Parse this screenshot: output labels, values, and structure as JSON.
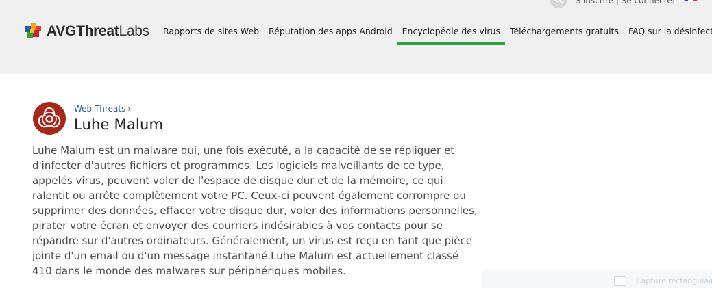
{
  "top_bar": {
    "login_text": "S'inscrire | Se connecter",
    "search_icon": "search-icon",
    "flag_icon": "flag-fr-icon"
  },
  "logo": {
    "part1": "AVG",
    "part2": "Threat",
    "part3": "Labs"
  },
  "nav": {
    "items": [
      {
        "label": "Rapports de sites Web",
        "active": false
      },
      {
        "label": "Réputation des apps Android",
        "active": false
      },
      {
        "label": "Encyclopédie des virus",
        "active": true
      },
      {
        "label": "Téléchargements gratuits",
        "active": false
      },
      {
        "label": "FAQ sur la désinfection",
        "active": false
      }
    ]
  },
  "article": {
    "icon": "biohazard-icon",
    "breadcrumb": "Web Threats",
    "breadcrumb_arrow": "›",
    "title": "Luhe Malum",
    "description": "Luhe Malum est un malware qui, une fois exécuté, a la capacité de se répliquer et d'infecter d'autres fichiers et programmes. Les logiciels malveillants de ce type, appelés virus, peuvent voler de l'espace de disque dur et de la mémoire, ce qui ralentit ou arrête complètement votre PC. Ceux-ci peuvent également corrompre ou supprimer des données, effacer votre disque dur, voler des informations personnelles, pirater votre écran et envoyer des courriers indésirables à vos contacts pour se répandre sur d'autres ordinateurs. Généralement, un virus est reçu en tant que pièce jointe d'un email ou d'un message instantané.Luhe Malum est actuellement classé 410 dans le monde des malwares sur périphériques mobiles."
  },
  "corner_widget": {
    "label": "Capture rectangulaire"
  },
  "colors": {
    "header_bg": "#f0f0f0",
    "accent_green": "#2da341",
    "icon_red": "#a9271a",
    "link_blue": "#2c5f95"
  }
}
